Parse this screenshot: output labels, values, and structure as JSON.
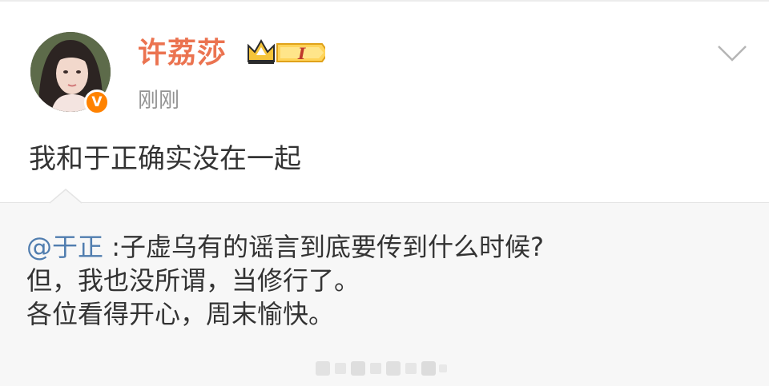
{
  "post": {
    "author": "许荔莎",
    "vip_level": "I",
    "time": "刚刚",
    "text": "我和于正确实没在一起",
    "verified_mark": "V"
  },
  "repost": {
    "mention": "@于正",
    "separator": " :",
    "lines": [
      "子虚乌有的谣言到底要传到什么时候?",
      "但，我也没所谓，当修行了。",
      "各位看得开心，周末愉快。"
    ]
  },
  "icons": {
    "avatar": "profile-photo",
    "verified": "orange-verified-badge-icon",
    "vip": "crown-vip-badge-icon",
    "menu": "chevron-down-icon"
  },
  "colors": {
    "username": "#eb7350",
    "mention": "#507daf",
    "verified": "#ff8200",
    "repost_bg": "#f7f7f7"
  }
}
